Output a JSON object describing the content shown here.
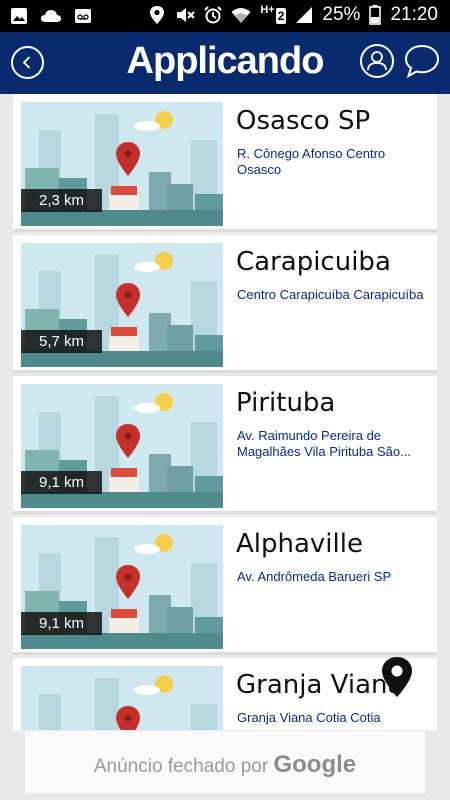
{
  "status_bar": {
    "battery": "25%",
    "time": "21:20",
    "network": "H+",
    "sim": "2",
    "icons": [
      "image-icon",
      "cloud-icon",
      "voicemail-icon",
      "location-icon",
      "mute-icon",
      "alarm-icon",
      "wifi-icon",
      "signal-icon",
      "battery-icon"
    ]
  },
  "app_bar": {
    "title": "Applicando",
    "icons": [
      "back-icon",
      "profile-icon",
      "chat-icon"
    ]
  },
  "locations": [
    {
      "distance": "2,3 km",
      "city": "Osasco SP",
      "address": "R. Cônego Afonso Centro Osasco"
    },
    {
      "distance": "5,7 km",
      "city": "Carapicuiba",
      "address": "Centro Carapicuíba Carapicuíba"
    },
    {
      "distance": "9,1 km",
      "city": "Pirituba",
      "address": "Av. Raimundo Pereira de Magalhães Vila Pirituba São..."
    },
    {
      "distance": "9,1 km",
      "city": "Alphaville",
      "address": "Av. Andrômeda Barueri SP"
    },
    {
      "distance": "",
      "city": "Granja Viana",
      "address": "Granja Viana Cotia Cotia"
    }
  ],
  "floating": {
    "icon": "map-pin-icon"
  },
  "ad": {
    "text": "Anúncio fechado por",
    "brand": "Google"
  },
  "colors": {
    "appbar": "#0a2a6f",
    "address": "#0a2a8a",
    "pin": "#c4302b",
    "sky": "#cfe7ee"
  }
}
